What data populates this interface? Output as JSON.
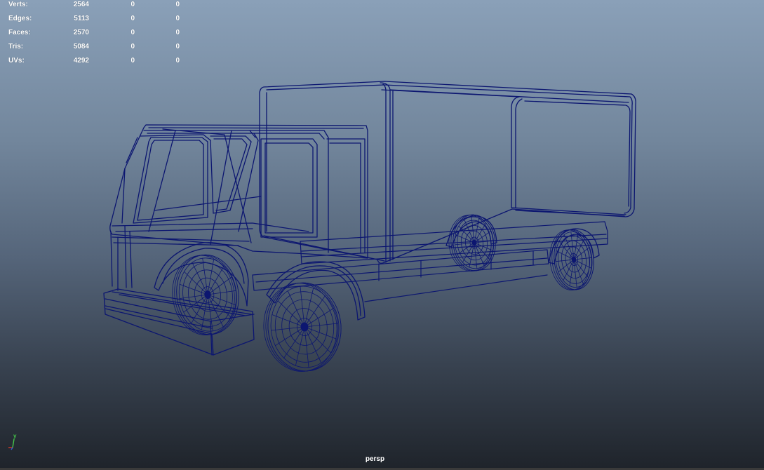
{
  "hud": {
    "rows": [
      {
        "label": "Verts:",
        "values": [
          "2564",
          "0",
          "0"
        ]
      },
      {
        "label": "Edges:",
        "values": [
          "5113",
          "0",
          "0"
        ]
      },
      {
        "label": "Faces:",
        "values": [
          "2570",
          "0",
          "0"
        ]
      },
      {
        "label": "Tris:",
        "values": [
          "5084",
          "0",
          "0"
        ]
      },
      {
        "label": "UVs:",
        "values": [
          "4292",
          "0",
          "0"
        ]
      }
    ]
  },
  "viewport": {
    "camera": "persp",
    "axis": {
      "y_label": "y"
    },
    "colors": {
      "wireframe": "#0c1670",
      "bg_top": "#8aa0b8",
      "bg_bottom": "#1f242b",
      "axis_x": "#d03a2a",
      "axis_y": "#46c84a",
      "axis_z": "#3a5ad8"
    }
  }
}
